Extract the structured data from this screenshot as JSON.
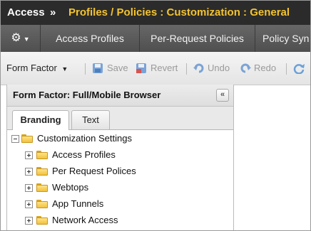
{
  "title": {
    "app": "Access",
    "separator": "»",
    "path": "Profiles / Policies : Customization : General"
  },
  "nav": {
    "gear_icon": "gear-icon",
    "tabs": [
      "Access Profiles",
      "Per-Request Policies",
      "Policy Syn"
    ]
  },
  "toolbar": {
    "form_factor_label": "Form Factor",
    "save_label": "Save",
    "revert_label": "Revert",
    "undo_label": "Undo",
    "redo_label": "Redo"
  },
  "panel": {
    "title": "Form Factor: Full/Mobile Browser",
    "collapse_symbol": "«",
    "tabs": [
      "Branding",
      "Text"
    ]
  },
  "tree": {
    "root": "Customization Settings",
    "children": [
      "Access Profiles",
      "Per Request Polices",
      "Webtops",
      "App Tunnels",
      "Network Access"
    ]
  },
  "colors": {
    "title_bg": "#2b2b2b",
    "title_accent": "#f4c430",
    "nav_bg": "#5b5b5b",
    "folder": "#f2c23c"
  }
}
